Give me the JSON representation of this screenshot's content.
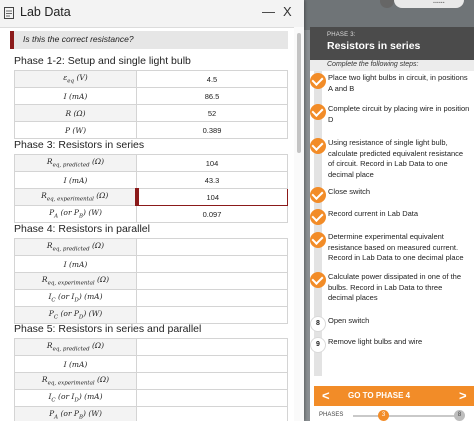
{
  "window": {
    "title": "Lab Data",
    "minimize": "—",
    "close": "X"
  },
  "question": "Is this the correct resistance?",
  "phase12": {
    "title": "Phase 1-2: Setup and single light bulb",
    "rows": [
      {
        "label": "ε",
        "sub": "eq",
        "unit": " (V)",
        "value": "4.5"
      },
      {
        "label": "I",
        "sub": "",
        "unit": " (mA)",
        "value": "86.5"
      },
      {
        "label": "R",
        "sub": "",
        "unit": " (Ω)",
        "value": "52"
      },
      {
        "label": "P",
        "sub": "",
        "unit": " (W)",
        "value": "0.389"
      }
    ]
  },
  "phase3": {
    "title": "Phase 3: Resistors in series",
    "rows": [
      {
        "label": "R",
        "sub": "eq, predicted",
        "unit": " (Ω)",
        "value": "104"
      },
      {
        "label": "I",
        "sub": "",
        "unit": " (mA)",
        "value": "43.3"
      },
      {
        "label": "R",
        "sub": "eq, experimental",
        "unit": " (Ω)",
        "value": "104"
      },
      {
        "label": "P",
        "sub": "A",
        "unit": " (or P",
        "sub2": "B",
        "unit2": ") (W)",
        "value": "0.097"
      }
    ]
  },
  "phase4": {
    "title": "Phase 4: Resistors in parallel",
    "rows": [
      {
        "label": "R",
        "sub": "eq, predicted",
        "unit": " (Ω)",
        "value": ""
      },
      {
        "label": "I",
        "sub": "",
        "unit": " (mA)",
        "value": ""
      },
      {
        "label": "R",
        "sub": "eq, experimental",
        "unit": " (Ω)",
        "value": ""
      },
      {
        "label": "I",
        "sub": "C",
        "unit": " (or I",
        "sub2": "D",
        "unit2": ") (mA)",
        "value": ""
      },
      {
        "label": "P",
        "sub": "C",
        "unit": " (or P",
        "sub2": "D",
        "unit2": ") (W)",
        "value": ""
      }
    ]
  },
  "phase5": {
    "title": "Phase 5: Resistors in series and parallel",
    "rows": [
      {
        "label": "R",
        "sub": "eq, predicted",
        "unit": " (Ω)",
        "value": ""
      },
      {
        "label": "I",
        "sub": "",
        "unit": " (mA)",
        "value": ""
      },
      {
        "label": "R",
        "sub": "eq, experimental",
        "unit": " (Ω)",
        "value": ""
      },
      {
        "label": "I",
        "sub": "C",
        "unit": " (or I",
        "sub2": "D",
        "unit2": ") (mA)",
        "value": ""
      },
      {
        "label": "P",
        "sub": "A",
        "unit": " (or P",
        "sub2": "B",
        "unit2": ") (W)",
        "value": ""
      }
    ]
  },
  "panel": {
    "phase_label": "PHASE 3:",
    "title": "Resistors in series",
    "subtitle": "Complete the following steps:",
    "steps": [
      {
        "status": "done",
        "marker": "",
        "text": "Place two light bulbs in circuit, in positions A and B"
      },
      {
        "status": "done",
        "marker": "",
        "text": "Complete circuit by placing wire in position D"
      },
      {
        "status": "done",
        "marker": "",
        "text": "Using resistance of single light bulb, calculate predicted equivalent resistance of circuit. Record in Lab Data to one decimal place"
      },
      {
        "status": "done",
        "marker": "",
        "text": "Close switch"
      },
      {
        "status": "done",
        "marker": "",
        "text": "Record current in Lab Data"
      },
      {
        "status": "done",
        "marker": "",
        "text": "Determine experimental equivalent resistance based on measured current. Record in Lab Data to one decimal place"
      },
      {
        "status": "done",
        "marker": "",
        "text": "Calculate power dissipated in one of the bulbs. Record in Lab Data to three decimal places"
      },
      {
        "status": "todo",
        "marker": "8",
        "text": "Open switch"
      },
      {
        "status": "todo",
        "marker": "9",
        "text": "Remove light bulbs and wire"
      }
    ],
    "nav_prev": "<",
    "nav_label": "GO TO PHASE 4",
    "nav_next": ">",
    "phases_label": "PHASES",
    "current_phase": "3",
    "last_phase": "8"
  },
  "colors": {
    "accent": "#f28c28",
    "active_border": "#8b1a1a",
    "panel_header": "#4b4b4b"
  }
}
